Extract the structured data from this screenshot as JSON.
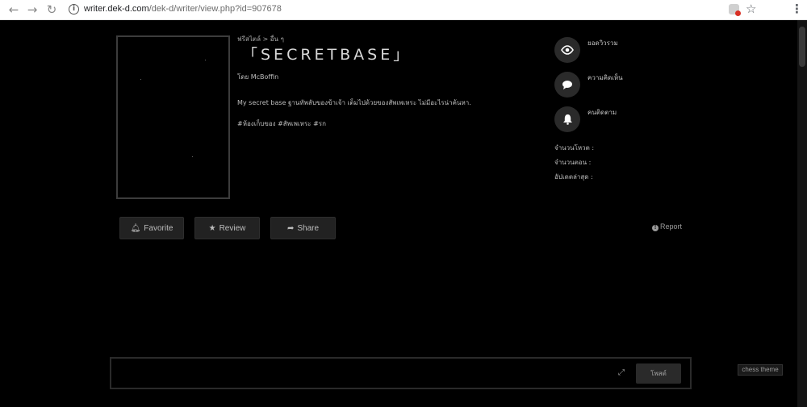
{
  "browser": {
    "url_domain": "writer.dek-d.com",
    "url_path": "/dek-d/writer/view.php?id=907678"
  },
  "story": {
    "breadcrumb": "ฟรีสไตล์ > อื่น ๆ",
    "title": "「SECRETBASE」",
    "author": "โดย McBoffin",
    "description": "My secret base ฐานทัพลับของข้าเจ้า เต็มไปด้วยของสัพเพเหระ ไม่มีอะไรน่าค้นหา.",
    "tags": "#ห้องเก็บของ #สัพเพเหระ #รก"
  },
  "stats": {
    "views_label": "ยอดวิวรวม",
    "comments_label": "ความคิดเห็น",
    "followers_label": "คนติดตาม",
    "votes_label": "จำนวนโหวต :",
    "episodes_label": "จำนวนตอน :",
    "updated_label": "อัปเดตล่าสุด :"
  },
  "actions": {
    "favorite": "Favorite",
    "review": "Review",
    "share": "Share",
    "report": "Report"
  },
  "comment": {
    "post_label": "โพสต์"
  },
  "theme_label": "chess theme",
  "colors": {
    "background": "#000000",
    "button_bg": "#222222",
    "stat_circle": "#2a2a2a"
  },
  "icons": {
    "views": "eye-icon",
    "comments": "speech-bubble-icon",
    "followers": "bell-icon",
    "favorite": "bell-icon",
    "review": "star-icon",
    "share": "share-arrow-icon",
    "report": "info-icon"
  }
}
